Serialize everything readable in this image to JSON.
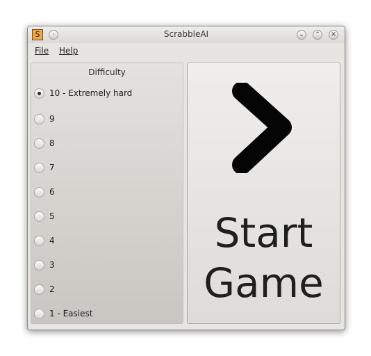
{
  "window": {
    "title": "ScrabbleAI",
    "app_icon_letter": "S",
    "controls": [
      "minimize",
      "maximize",
      "close"
    ]
  },
  "menu": {
    "items": [
      {
        "label": "File"
      },
      {
        "label": "Help"
      }
    ]
  },
  "difficulty": {
    "title": "Difficulty",
    "selected": "10 - Extremely hard",
    "options": [
      {
        "label": "10 - Extremely hard",
        "checked": true
      },
      {
        "label": "9",
        "checked": false
      },
      {
        "label": "8",
        "checked": false
      },
      {
        "label": "7",
        "checked": false
      },
      {
        "label": "6",
        "checked": false
      },
      {
        "label": "5",
        "checked": false
      },
      {
        "label": "4",
        "checked": false
      },
      {
        "label": "3",
        "checked": false
      },
      {
        "label": "2",
        "checked": false
      },
      {
        "label": "1 - Easiest",
        "checked": false
      }
    ]
  },
  "start": {
    "label": "Start\nGame",
    "icon": "chevron-right-icon"
  },
  "colors": {
    "window_bg": "#e7e5e1",
    "app_icon_bg": "#f0a64a",
    "text": "#1f1f1f"
  }
}
